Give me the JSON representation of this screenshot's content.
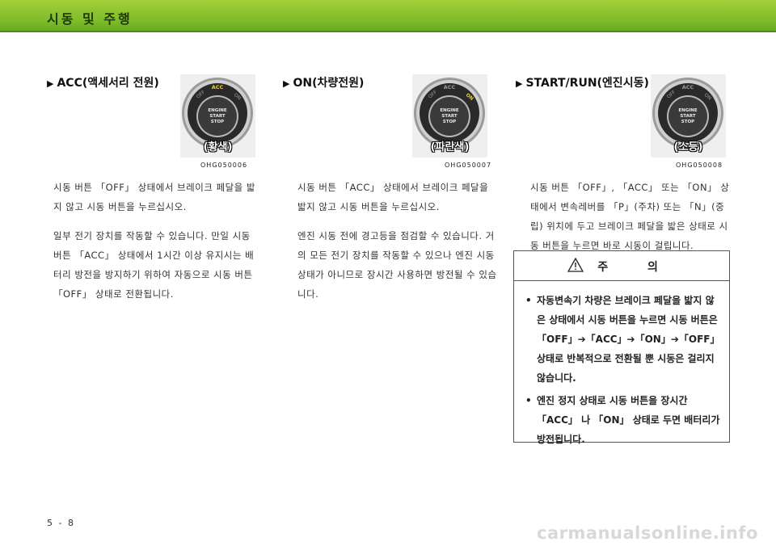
{
  "header": {
    "title": "시동 및 주행"
  },
  "sections": [
    {
      "title": "ACC(액세서리 전원)",
      "knob": {
        "ring_labels": {
          "left": "OFF",
          "top": "ACC",
          "right": "ON"
        },
        "button_lines": [
          "ENGINE",
          "START",
          "STOP"
        ],
        "tag": "(황색)",
        "lit": "top"
      },
      "image_code": "OHG050006",
      "paragraphs": [
        "시동 버튼 「OFF」 상태에서 브레이크 페달을 밟지 않고 시동 버튼을 누르십시오.",
        "일부 전기 장치를 작동할 수 있습니다. 만일 시동 버튼 「ACC」 상태에서 1시간 이상 유지시는 배터리 방전을 방지하기 위하여 자동으로 시동 버튼 「OFF」 상태로 전환됩니다."
      ]
    },
    {
      "title": "ON(차량전원)",
      "knob": {
        "ring_labels": {
          "left": "OFF",
          "top": "ACC",
          "right": "ON"
        },
        "button_lines": [
          "ENGINE",
          "START",
          "STOP"
        ],
        "tag": "(파란색)",
        "lit": "right"
      },
      "image_code": "OHG050007",
      "paragraphs": [
        "시동 버튼 「ACC」 상태에서 브레이크 페달을 밟지 않고 시동 버튼을 누르십시오.",
        "엔진 시동 전에 경고등을 점검할 수 있습니다. 거의 모든 전기 장치를 작동할 수 있으나 엔진 시동 상태가 아니므로 장시간 사용하면 방전될 수 있습니다."
      ]
    },
    {
      "title": "START/RUN(엔진시동)",
      "knob": {
        "ring_labels": {
          "left": "OFF",
          "top": "ACC",
          "right": "ON"
        },
        "button_lines": [
          "ENGINE",
          "START",
          "STOP"
        ],
        "tag": "(소등)",
        "lit": "none"
      },
      "image_code": "OHG050008",
      "paragraphs": [
        "시동 버튼 「OFF」, 「ACC」 또는 「ON」 상태에서 변속레버를 「P」(주차) 또는 「N」(중립) 위치에 두고 브레이크 페달을 밟은 상태로 시동 버튼을 누르면 바로 시동이 걸립니다."
      ]
    }
  ],
  "caution": {
    "icon": "warning-triangle-icon",
    "title": "주 의",
    "items": [
      "자동변속기 차량은 브레이크 페달을 밟지 않은 상태에서 시동 버튼을 누르면 시동 버튼은 「OFF」➔「ACC」➔「ON」➔「OFF」 상태로 반복적으로 전환될 뿐 시동은 걸리지 않습니다.",
      "엔진 정지 상태로 시동 버튼을 장시간 「ACC」 나 「ON」 상태로 두면 배터리가 방전됩니다."
    ]
  },
  "footer": {
    "page_number": "5 - 8"
  },
  "watermark": "carmanualsonline.info",
  "colors": {
    "header_green": "#8cc430",
    "lit_yellow": "#f0d020",
    "lit_blue_label": "#f0d020"
  }
}
